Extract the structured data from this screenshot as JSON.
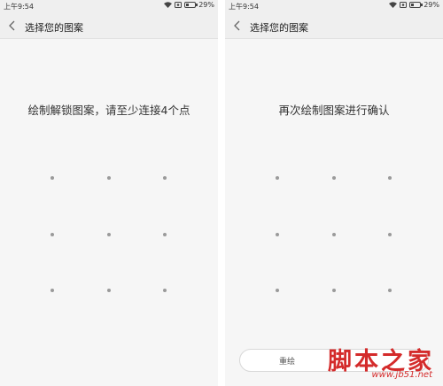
{
  "status_bar": {
    "time": "上午9:54",
    "battery": "29%",
    "battery_level": 0.29,
    "icons": [
      "wifi-icon",
      "alarm-icon",
      "battery-icon"
    ]
  },
  "header": {
    "title": "选择您的图案",
    "back_icon": "chevron-left-icon"
  },
  "screen_left": {
    "prompt": "绘制解锁图案，请至少连接4个点"
  },
  "screen_right": {
    "prompt": "再次绘制图案进行确认",
    "reset_label": "重绘"
  },
  "watermark": {
    "text": "脚本之家",
    "url": "www.jb51.net",
    "color": "#d42b2b"
  },
  "colors": {
    "background": "#f6f6f6",
    "bar": "#efefef",
    "dot": "#9a9a9a"
  }
}
